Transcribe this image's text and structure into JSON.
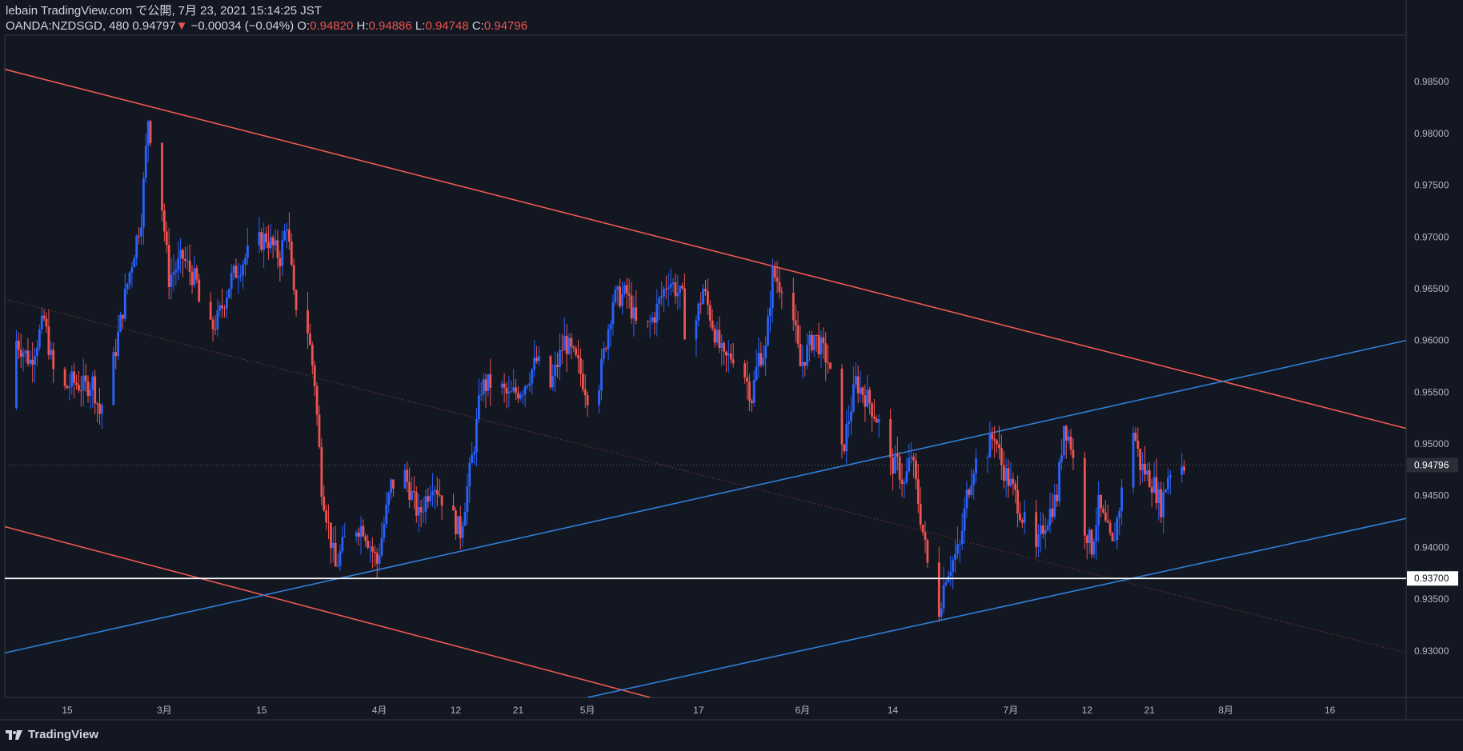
{
  "header": {
    "published": "lebain TradingView.com で公開, 7月 23, 2021 15:14:25 JST",
    "symbol": "OANDA:NZDSGD, 480",
    "last": "0.94797",
    "arrow": "▼",
    "change": "−0.00034 (−0.04%)",
    "o_label": "O:",
    "o_value": "0.94820",
    "h_label": "H:",
    "h_value": "0.94886",
    "l_label": "L:",
    "l_value": "0.94748",
    "c_label": "C:",
    "c_value": "0.94796"
  },
  "footer": {
    "brand": "TradingView"
  },
  "colors": {
    "background": "#131722",
    "up": "#2962ff",
    "down": "#ef5350",
    "resistance": "#f05a50",
    "support": "#2f7fd8",
    "hline": "#ffffff",
    "grid_text": "#b2b5be"
  },
  "chart_data": {
    "type": "candlestick",
    "symbol": "OANDA:NZDSGD",
    "interval": "480",
    "ylim": [
      0.9255,
      0.9895
    ],
    "x_range": [
      "2021-02-06",
      "2021-08-27"
    ],
    "y_ticks": [
      "0.98500",
      "0.98000",
      "0.97500",
      "0.97000",
      "0.96500",
      "0.96000",
      "0.95500",
      "0.95000",
      "0.94500",
      "0.94000",
      "0.93500",
      "0.93000"
    ],
    "y_tick_values": [
      0.985,
      0.98,
      0.975,
      0.97,
      0.965,
      0.96,
      0.955,
      0.95,
      0.945,
      0.94,
      0.935,
      0.93
    ],
    "x_ticks": [
      {
        "label": "15",
        "date": "2021-02-15"
      },
      {
        "label": "3月",
        "date": "2021-03-01"
      },
      {
        "label": "15",
        "date": "2021-03-15"
      },
      {
        "label": "4月",
        "date": "2021-04-01"
      },
      {
        "label": "12",
        "date": "2021-04-12"
      },
      {
        "label": "21",
        "date": "2021-04-21"
      },
      {
        "label": "5月",
        "date": "2021-05-01"
      },
      {
        "label": "17",
        "date": "2021-05-17"
      },
      {
        "label": "6月",
        "date": "2021-06-01"
      },
      {
        "label": "14",
        "date": "2021-06-14"
      },
      {
        "label": "7月",
        "date": "2021-07-01"
      },
      {
        "label": "12",
        "date": "2021-07-12"
      },
      {
        "label": "21",
        "date": "2021-07-21"
      },
      {
        "label": "8月",
        "date": "2021-08-01"
      },
      {
        "label": "16",
        "date": "2021-08-16"
      }
    ],
    "current_price": {
      "value": 0.94796,
      "label": "0.94796"
    },
    "horizontal_line": {
      "value": 0.937,
      "label": "0.93700"
    },
    "trendlines": [
      {
        "name": "resistance-upper",
        "color": "#f05a50",
        "from": [
          "2021-02-06",
          0.9862
        ],
        "to": [
          "2021-08-27",
          0.9515
        ]
      },
      {
        "name": "resistance-lower",
        "color": "#f05a50",
        "from": [
          "2021-02-06",
          0.942
        ],
        "to": [
          "2021-05-10",
          0.9255
        ]
      },
      {
        "name": "channel-upper",
        "color": "#2f7fd8",
        "from": [
          "2021-02-06",
          0.9298
        ],
        "to": [
          "2021-08-27",
          0.96
        ]
      },
      {
        "name": "channel-lower",
        "color": "#2f7fd8",
        "from": [
          "2021-05-01",
          0.9255
        ],
        "to": [
          "2021-08-27",
          0.9428
        ]
      },
      {
        "name": "midline-dotted",
        "color": "#f05a50",
        "dotted": true,
        "from": [
          "2021-02-06",
          0.964
        ],
        "to": [
          "2021-08-27",
          0.9298
        ]
      }
    ],
    "price_path": [
      [
        "2021-02-06",
        0.9535
      ],
      [
        "2021-02-08",
        0.96
      ],
      [
        "2021-02-10",
        0.958
      ],
      [
        "2021-02-12",
        0.962
      ],
      [
        "2021-02-14",
        0.9545
      ],
      [
        "2021-02-16",
        0.956
      ],
      [
        "2021-02-18",
        0.9555
      ],
      [
        "2021-02-19",
        0.956
      ],
      [
        "2021-02-20",
        0.953
      ],
      [
        "2021-02-22",
        0.958
      ],
      [
        "2021-02-24",
        0.9655
      ],
      [
        "2021-02-26",
        0.972
      ],
      [
        "2021-02-27",
        0.9815
      ],
      [
        "2021-02-28",
        0.977
      ],
      [
        "2021-03-01",
        0.973
      ],
      [
        "2021-03-02",
        0.966
      ],
      [
        "2021-03-04",
        0.968
      ],
      [
        "2021-03-06",
        0.9655
      ],
      [
        "2021-03-07",
        0.96
      ],
      [
        "2021-03-09",
        0.962
      ],
      [
        "2021-03-11",
        0.966
      ],
      [
        "2021-03-14",
        0.969
      ],
      [
        "2021-03-16",
        0.97
      ],
      [
        "2021-03-18",
        0.968
      ],
      [
        "2021-03-19",
        0.9715
      ],
      [
        "2021-03-20",
        0.964
      ],
      [
        "2021-03-22",
        0.961
      ],
      [
        "2021-03-23",
        0.956
      ],
      [
        "2021-03-24",
        0.946
      ],
      [
        "2021-03-26",
        0.938
      ],
      [
        "2021-03-28",
        0.942
      ],
      [
        "2021-03-30",
        0.942
      ],
      [
        "2021-04-01",
        0.9385
      ],
      [
        "2021-04-03",
        0.946
      ],
      [
        "2021-04-05",
        0.947
      ],
      [
        "2021-04-07",
        0.943
      ],
      [
        "2021-04-09",
        0.9465
      ],
      [
        "2021-04-11",
        0.944
      ],
      [
        "2021-04-13",
        0.9415
      ],
      [
        "2021-04-15",
        0.95
      ],
      [
        "2021-04-16",
        0.9555
      ],
      [
        "2021-04-18",
        0.956
      ],
      [
        "2021-04-20",
        0.9545
      ],
      [
        "2021-04-22",
        0.9555
      ],
      [
        "2021-04-24",
        0.958
      ],
      [
        "2021-04-26",
        0.9555
      ],
      [
        "2021-04-28",
        0.96
      ],
      [
        "2021-04-30",
        0.9575
      ],
      [
        "2021-05-02",
        0.9535
      ],
      [
        "2021-05-03",
        0.956
      ],
      [
        "2021-05-05",
        0.964
      ],
      [
        "2021-05-07",
        0.9645
      ],
      [
        "2021-05-09",
        0.96
      ],
      [
        "2021-05-11",
        0.9625
      ],
      [
        "2021-05-13",
        0.966
      ],
      [
        "2021-05-15",
        0.964
      ],
      [
        "2021-05-16",
        0.9555
      ],
      [
        "2021-05-17",
        0.962
      ],
      [
        "2021-05-18",
        0.965
      ],
      [
        "2021-05-20",
        0.96
      ],
      [
        "2021-05-21",
        0.958
      ],
      [
        "2021-05-23",
        0.959
      ],
      [
        "2021-05-25",
        0.9545
      ],
      [
        "2021-05-26",
        0.9585
      ],
      [
        "2021-05-27",
        0.959
      ],
      [
        "2021-05-28",
        0.9665
      ],
      [
        "2021-05-29",
        0.9655
      ],
      [
        "2021-05-30",
        0.966
      ],
      [
        "2021-05-31",
        0.962
      ],
      [
        "2021-06-01",
        0.9575
      ],
      [
        "2021-06-03",
        0.9605
      ],
      [
        "2021-06-05",
        0.958
      ],
      [
        "2021-06-07",
        0.949
      ],
      [
        "2021-06-09",
        0.956
      ],
      [
        "2021-06-11",
        0.954
      ],
      [
        "2021-06-13",
        0.951
      ],
      [
        "2021-06-14",
        0.948
      ],
      [
        "2021-06-15",
        0.948
      ],
      [
        "2021-06-16",
        0.946
      ],
      [
        "2021-06-17",
        0.949
      ],
      [
        "2021-06-19",
        0.94
      ],
      [
        "2021-06-20",
        0.935
      ],
      [
        "2021-06-21",
        0.934
      ],
      [
        "2021-06-22",
        0.9375
      ],
      [
        "2021-06-24",
        0.94
      ],
      [
        "2021-06-25",
        0.945
      ],
      [
        "2021-06-26",
        0.948
      ],
      [
        "2021-06-28",
        0.9495
      ],
      [
        "2021-06-29",
        0.951
      ],
      [
        "2021-06-30",
        0.948
      ],
      [
        "2021-07-02",
        0.945
      ],
      [
        "2021-07-04",
        0.941
      ],
      [
        "2021-07-05",
        0.9395
      ],
      [
        "2021-07-06",
        0.942
      ],
      [
        "2021-07-08",
        0.945
      ],
      [
        "2021-07-09",
        0.952
      ],
      [
        "2021-07-10",
        0.95
      ],
      [
        "2021-07-11",
        0.945
      ],
      [
        "2021-07-12",
        0.942
      ],
      [
        "2021-07-13",
        0.94
      ],
      [
        "2021-07-14",
        0.944
      ],
      [
        "2021-07-15",
        0.942
      ],
      [
        "2021-07-16",
        0.94
      ],
      [
        "2021-07-17",
        0.944
      ],
      [
        "2021-07-18",
        0.948
      ],
      [
        "2021-07-19",
        0.9515
      ],
      [
        "2021-07-20",
        0.948
      ],
      [
        "2021-07-21",
        0.947
      ],
      [
        "2021-07-22",
        0.946
      ],
      [
        "2021-07-23",
        0.944
      ],
      [
        "2021-07-24",
        0.947
      ],
      [
        "2021-07-25",
        0.9485
      ],
      [
        "2021-07-26",
        0.948
      ]
    ]
  }
}
